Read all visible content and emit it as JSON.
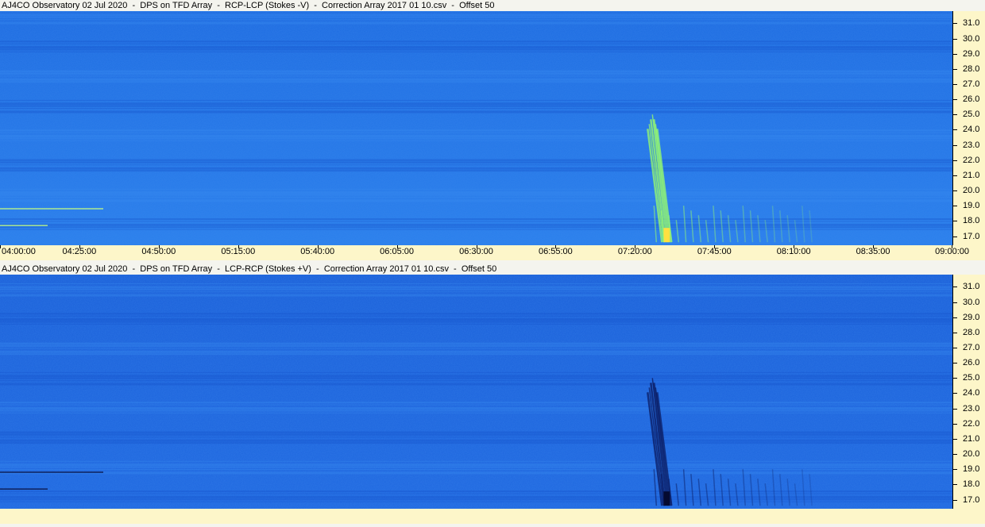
{
  "chart_data": [
    {
      "type": "heatmap",
      "title": "AJ4CO Observatory 02 Jul 2020  -  DPS on TFD Array  -  RCP-LCP (Stokes -V)  -  Correction Array 2017 01 10.csv  -  Offset 50",
      "x_ticks": [
        "04:00:00",
        "04:25:00",
        "04:50:00",
        "05:15:00",
        "05:40:00",
        "06:05:00",
        "06:30:00",
        "06:55:00",
        "07:20:00",
        "07:45:00",
        "08:10:00",
        "08:35:00",
        "09:00:00"
      ],
      "y_ticks": [
        "31.0",
        "30.0",
        "29.0",
        "28.0",
        "27.0",
        "26.0",
        "25.0",
        "24.0",
        "23.0",
        "22.0",
        "21.0",
        "20.0",
        "19.0",
        "18.0",
        "17.0"
      ],
      "xlim": [
        "04:00:00",
        "09:00:00"
      ],
      "ylim_mhz": [
        16.4,
        31.8
      ],
      "colormap": {
        "background": "#1f6fe0",
        "burst": "#9aff6a",
        "polarity": "positive"
      },
      "features": [
        {
          "kind": "burst",
          "time_start": "07:24:00",
          "time_end": "07:27:00",
          "freq_low": 16.6,
          "freq_high": 25.0
        },
        {
          "kind": "drift",
          "time_start": "07:26:00",
          "time_end": "08:15:00",
          "freq_low": 16.6,
          "freq_high": 19.0
        }
      ]
    },
    {
      "type": "heatmap",
      "title": "AJ4CO Observatory 02 Jul 2020  -  DPS on TFD Array  -  LCP-RCP (Stokes +V)  -  Correction Array 2017 01 10.csv  -  Offset 50",
      "x_ticks": [],
      "y_ticks": [
        "31.0",
        "30.0",
        "29.0",
        "28.0",
        "27.0",
        "26.0",
        "25.0",
        "24.0",
        "23.0",
        "22.0",
        "21.0",
        "20.0",
        "19.0",
        "18.0",
        "17.0"
      ],
      "xlim": [
        "04:00:00",
        "09:00:00"
      ],
      "ylim_mhz": [
        16.4,
        31.8
      ],
      "colormap": {
        "background": "#1f6fe0",
        "burst": "#0a1a60",
        "polarity": "negative"
      },
      "features": [
        {
          "kind": "burst",
          "time_start": "07:24:00",
          "time_end": "07:27:00",
          "freq_low": 16.6,
          "freq_high": 25.0
        },
        {
          "kind": "drift",
          "time_start": "07:26:00",
          "time_end": "08:15:00",
          "freq_low": 16.6,
          "freq_high": 19.0
        }
      ]
    }
  ]
}
